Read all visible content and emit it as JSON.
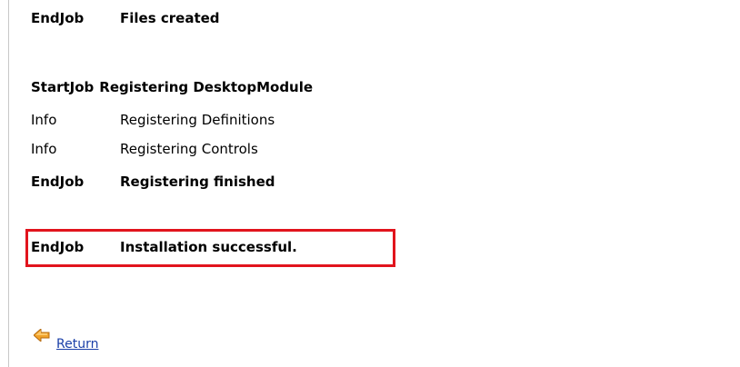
{
  "log": {
    "rows": [
      {
        "type": "EndJob",
        "message": "Files created"
      },
      {
        "type": "StartJob",
        "message": "Registering DesktopModule"
      },
      {
        "type": "Info",
        "message": "Registering Definitions"
      },
      {
        "type": "Info",
        "message": "Registering Controls"
      },
      {
        "type": "EndJob",
        "message": "Registering finished"
      },
      {
        "type": "EndJob",
        "message": "Installation successful."
      }
    ]
  },
  "highlight": {
    "border_color": "#e1141d"
  },
  "return_link": {
    "label": "Return",
    "icon": "back-arrow-icon",
    "color": "#1a3fa8"
  }
}
